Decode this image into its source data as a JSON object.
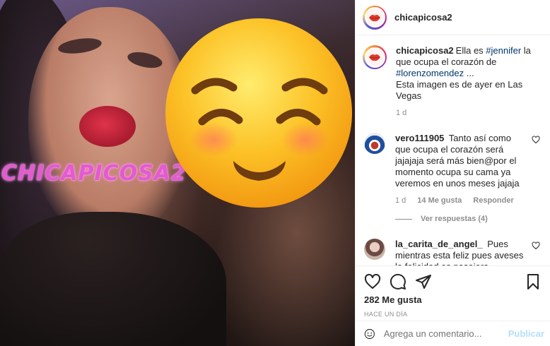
{
  "photo": {
    "watermark": "CHICAPICOSA2",
    "overlay_icon": "relieved-face-emoji"
  },
  "header": {
    "username": "chicapicosa2",
    "avatar_icon": "lips-avatar"
  },
  "caption": {
    "username": "chicapicosa2",
    "text_1": "Ella es ",
    "tag_1": "#jennifer",
    "text_2": " la que ocupa el corazón de ",
    "tag_2": "#lorenzomendez",
    "text_3": " ...",
    "text_4": "Esta imagen es de ayer en Las Vegas",
    "time": "1 d"
  },
  "comments": [
    {
      "username": "vero111905",
      "text": "Tanto así como que ocupa el corazón será jajajaja será más bien@por el momento ocupa su cama ya veremos en unos meses jajaja",
      "time": "1 d",
      "likes": "14 Me gusta",
      "reply": "Responder",
      "view_replies": "Ver respuestas (4)",
      "avatar_color": "#d9dde8"
    },
    {
      "username": "la_carita_de_angel_",
      "text": "Pues mientras esta feliz pues aveses la felicidad es pasajera",
      "avatar_color": "#c8a89a"
    }
  ],
  "actions": {
    "icons": [
      "heart-icon",
      "comment-icon",
      "share-icon",
      "bookmark-icon"
    ],
    "likes": "282 Me gusta",
    "posted": "HACE UN DÍA"
  },
  "add_comment": {
    "placeholder": "Agrega un comentario...",
    "publish": "Publicar"
  },
  "colors": {
    "link": "#00376b",
    "muted": "#8e8e8e",
    "publish_disabled": "#b2dffc"
  }
}
